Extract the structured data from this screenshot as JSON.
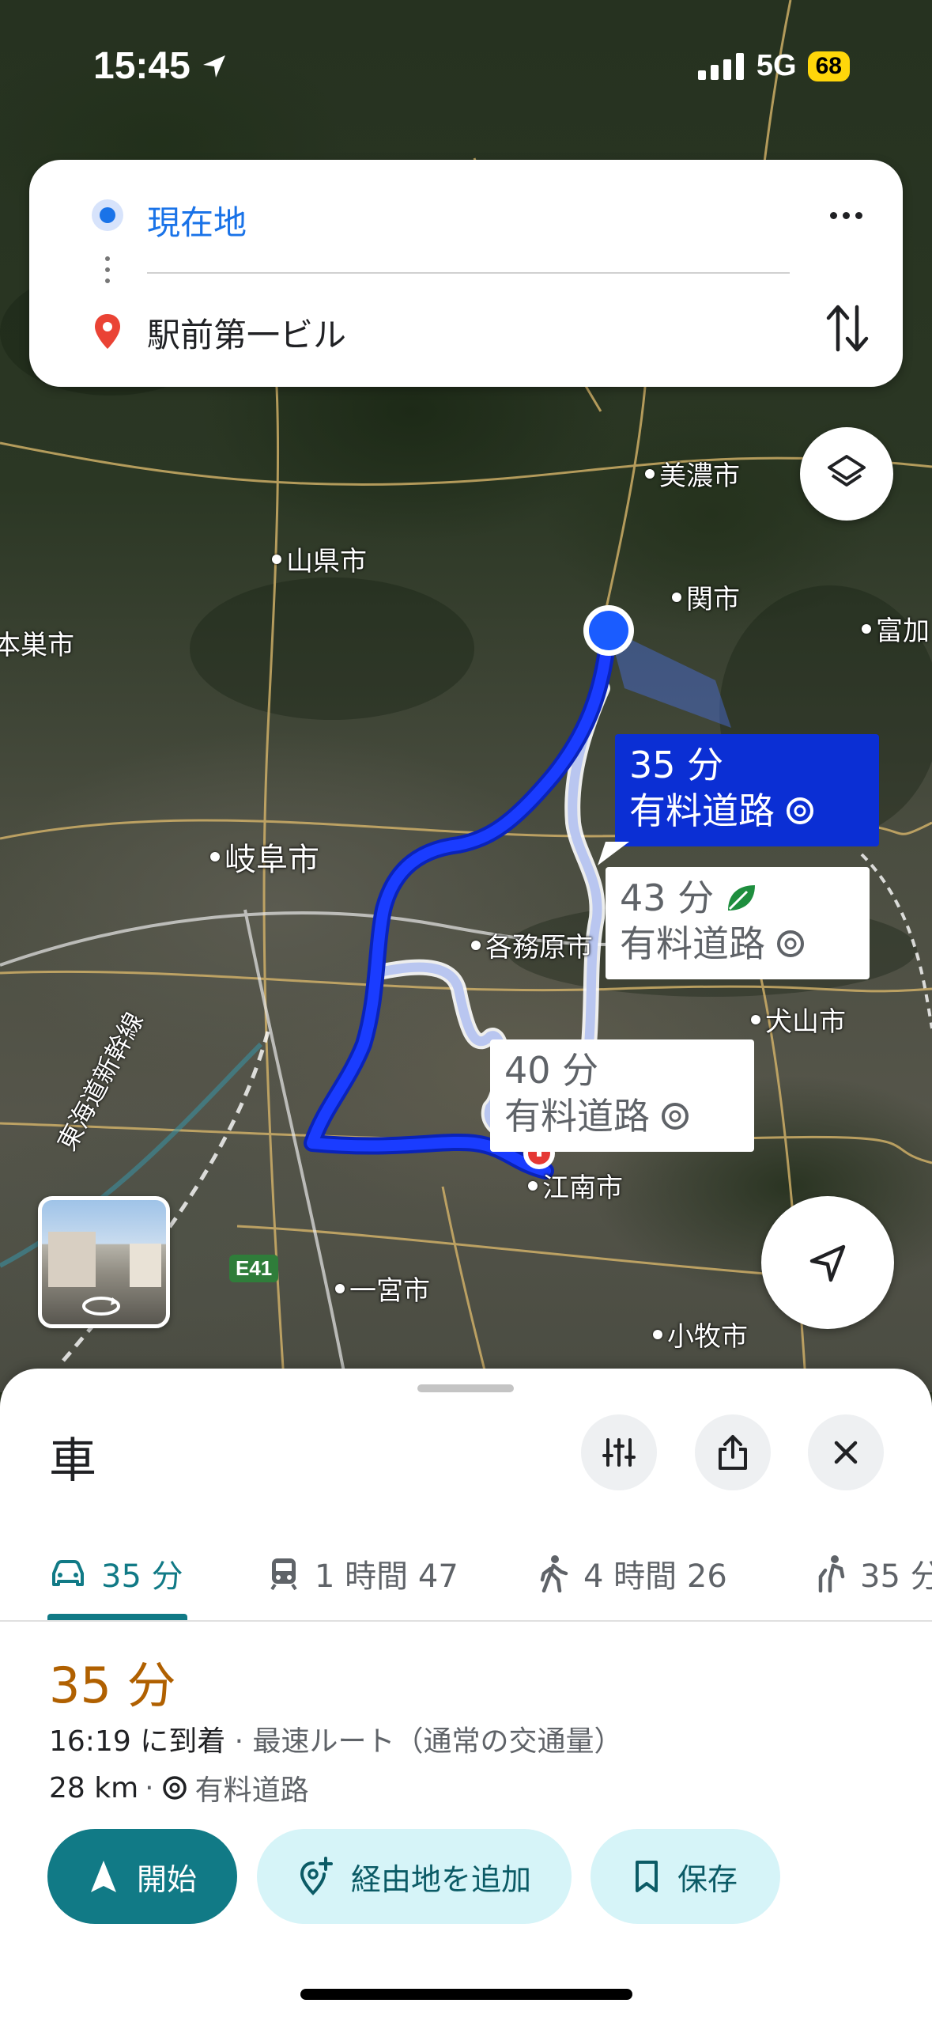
{
  "status_bar": {
    "time": "15:45",
    "network": "5G",
    "battery": "68"
  },
  "search": {
    "origin": "現在地",
    "destination": "駅前第一ビル"
  },
  "map": {
    "places": {
      "mino": "美濃市",
      "yamagata": "山県市",
      "seki": "関市",
      "tomika": "富加",
      "motosu": "本巣市",
      "gifu": "岐阜市",
      "kakamigahara": "各務原市",
      "inuyama": "犬山市",
      "konan": "江南市",
      "ichinomiya": "一宮市",
      "komaki": "小牧市",
      "rail_line": "東海道新幹線",
      "expressway": "E41"
    },
    "routes": [
      {
        "time": "35 分",
        "note": "有料道路",
        "selected": true
      },
      {
        "time": "43 分",
        "note": "有料道路",
        "eco": true
      },
      {
        "time": "40 分",
        "note": "有料道路"
      }
    ]
  },
  "sheet": {
    "title": "車",
    "tabs": [
      {
        "icon": "car-icon",
        "label": "35 分"
      },
      {
        "icon": "train-icon",
        "label": "1 時間 47"
      },
      {
        "icon": "walk-icon",
        "label": "4 時間 26"
      },
      {
        "icon": "ride-icon",
        "label": "35 分"
      }
    ],
    "duration": "35 分",
    "arrival": "16:19 に到着",
    "arrival_note": "· 最速ルート（通常の交通量）",
    "distance": "28 km",
    "distance_note": "有料道路",
    "actions": {
      "start": "開始",
      "add_stop": "経由地を追加",
      "save": "保存"
    }
  },
  "colors": {
    "accent": "#117a86",
    "route_primary": "#0b2fd4",
    "route_alt": "#b9c6f0",
    "duration": "#b06000"
  }
}
